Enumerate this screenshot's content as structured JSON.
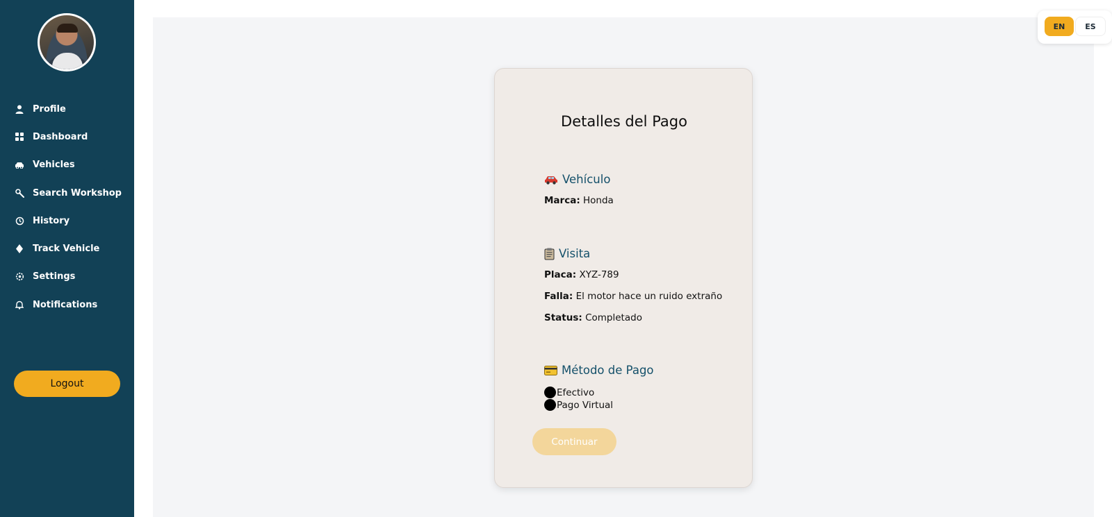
{
  "sidebar": {
    "items": [
      {
        "label": "Profile",
        "icon": "user-icon"
      },
      {
        "label": "Dashboard",
        "icon": "grid-icon"
      },
      {
        "label": "Vehicles",
        "icon": "car-icon"
      },
      {
        "label": "Search Workshop",
        "icon": "wrench-icon"
      },
      {
        "label": "History",
        "icon": "history-icon"
      },
      {
        "label": "Track Vehicle",
        "icon": "location-pin-icon"
      },
      {
        "label": "Settings",
        "icon": "gear-icon"
      },
      {
        "label": "Notifications",
        "icon": "bell-icon"
      }
    ],
    "logout_label": "Logout"
  },
  "language": {
    "options": [
      "EN",
      "ES"
    ],
    "selected": "EN"
  },
  "payment": {
    "title": "Detalles del Pago",
    "vehicle": {
      "heading": "Vehículo",
      "brand_label": "Marca:",
      "brand_value": "Honda"
    },
    "visit": {
      "heading": "Visita",
      "plate_label": "Placa:",
      "plate_value": "XYZ-789",
      "fault_label": "Falla:",
      "fault_value": "El motor hace un ruido extraño",
      "status_label": "Status:",
      "status_value": "Completado"
    },
    "method": {
      "heading": "Método de Pago",
      "options": [
        "Efectivo",
        "Pago Virtual"
      ]
    },
    "continue_label": "Continuar"
  },
  "colors": {
    "sidebar_bg": "#124156",
    "accent": "#f1ab1f",
    "heading": "#14506a",
    "card_bg": "#f0ebe7",
    "main_bg": "#f4f5f7"
  }
}
